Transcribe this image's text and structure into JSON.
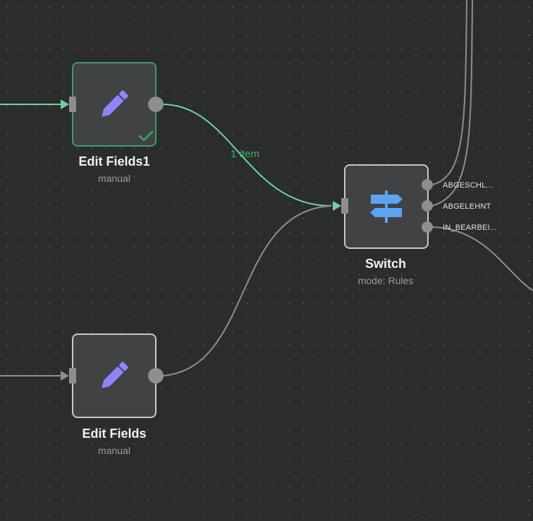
{
  "nodes": {
    "edit_fields1": {
      "title": "Edit Fields1",
      "subtitle": "manual",
      "icon": "pencil-icon",
      "status": "success",
      "icon_color": "#8b87fb",
      "border_color": "#3f9d62"
    },
    "edit_fields": {
      "title": "Edit Fields",
      "subtitle": "manual",
      "icon": "pencil-icon",
      "icon_color": "#8b87fb"
    },
    "switch": {
      "title": "Switch",
      "subtitle": "mode: Rules",
      "icon": "signpost-icon",
      "icon_color": "#5aa4f0",
      "outputs": [
        {
          "label": "ABGESCHL..."
        },
        {
          "label": "ABGELEHNT"
        },
        {
          "label": "IN_BEARBEI..."
        }
      ]
    }
  },
  "connections": {
    "edit_fields1_to_switch": {
      "label": "1 item",
      "color": "#6fd39a"
    }
  },
  "colors": {
    "canvas_background": "#2b2c2c",
    "node_background": "#414244",
    "node_border": "#c9c9cc",
    "wire_default": "#8d8e91",
    "wire_active": "#6fd39a",
    "success": "#3f9d62"
  }
}
